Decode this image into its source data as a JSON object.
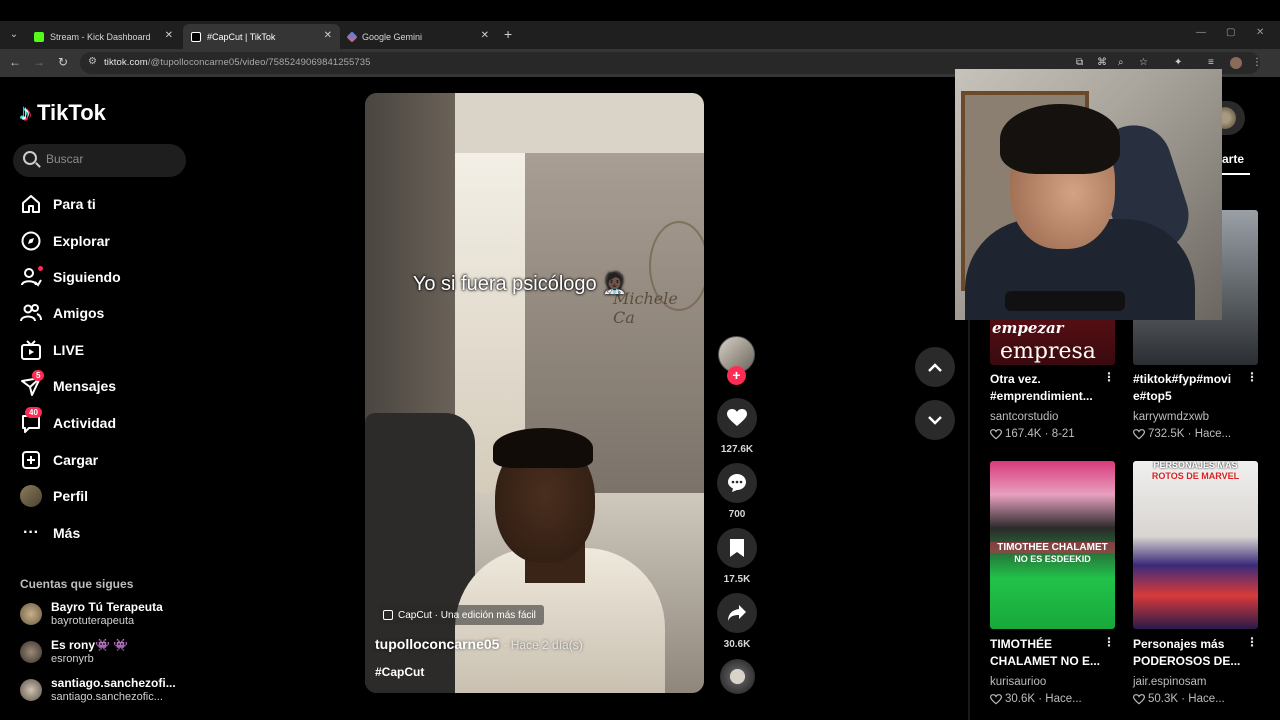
{
  "browser": {
    "tabs": [
      {
        "title": "Stream - Kick Dashboard",
        "favicon_color": "#53fc18",
        "active": false
      },
      {
        "title": "#CapCut | TikTok",
        "favicon_color": "#ffffff",
        "active": true
      },
      {
        "title": "Google Gemini",
        "favicon_color": "#6c8cff",
        "active": false
      }
    ],
    "url_host": "tiktok.com",
    "url_path": "/@tupolloconcarne05/video/7585249069841255735"
  },
  "sidebar": {
    "logo": "TikTok",
    "search_placeholder": "Buscar",
    "nav": [
      {
        "label": "Para ti",
        "icon": "home-icon"
      },
      {
        "label": "Explorar",
        "icon": "compass-icon"
      },
      {
        "label": "Siguiendo",
        "icon": "user-follow-icon"
      },
      {
        "label": "Amigos",
        "icon": "friends-icon"
      },
      {
        "label": "LIVE",
        "icon": "live-tv-icon"
      },
      {
        "label": "Mensajes",
        "icon": "send-icon",
        "badge": "5"
      },
      {
        "label": "Actividad",
        "icon": "inbox-icon",
        "badge": "40"
      },
      {
        "label": "Cargar",
        "icon": "upload-icon"
      },
      {
        "label": "Perfil",
        "icon": "profile-avatar"
      },
      {
        "label": "Más",
        "icon": "more-icon"
      }
    ],
    "following_header": "Cuentas que sigues",
    "following": [
      {
        "name": "Bayro Tú Terapeuta",
        "handle": "bayrotuterapeuta"
      },
      {
        "name": "Es rony👾 👾",
        "handle": "esronyrb"
      },
      {
        "name": "santiago.sanchezofi...",
        "handle": "santiago.sanchezofic..."
      }
    ]
  },
  "video": {
    "caption_overlay": "Yo si fuera psicólogo 🧑🏿‍⚕️",
    "wall_logo": "Michele Ca",
    "capcut_label": "CapCut · Una edición más fácil",
    "author": "tupolloconcarne05",
    "time": "· Hace 2 día(s)",
    "hashtag": "#CapCut",
    "likes": "127.6K",
    "comments": "700",
    "saves": "17.5K",
    "shares": "30.6K"
  },
  "right_panel": {
    "tab_label": "arte",
    "cards": [
      {
        "title": "Otra vez. #emprendimient...",
        "author": "santcorstudio",
        "views": "167.4K",
        "date": "8-21",
        "thumb_text_1": "empezar",
        "thumb_text_2": "empresa"
      },
      {
        "title": "#tiktok#fyp#movi e#top5",
        "author": "karrywmdzxwb",
        "views": "732.5K",
        "date": "Hace..."
      },
      {
        "title": "TIMOTHÉE CHALAMET NO E...",
        "author": "kurisaurioo",
        "views": "30.6K",
        "date": "Hace...",
        "thumb_text_1": "TIMOTHEE CHALAMET",
        "thumb_text_2": "NO ES ESDEEKID"
      },
      {
        "title": "Personajes más PODEROSOS DE...",
        "author": "jair.espinosam",
        "views": "50.3K",
        "date": "Hace...",
        "thumb_text_1": "PERSONAJES MÁS",
        "thumb_text_2": "ROTOS DE MARVEL"
      }
    ]
  }
}
